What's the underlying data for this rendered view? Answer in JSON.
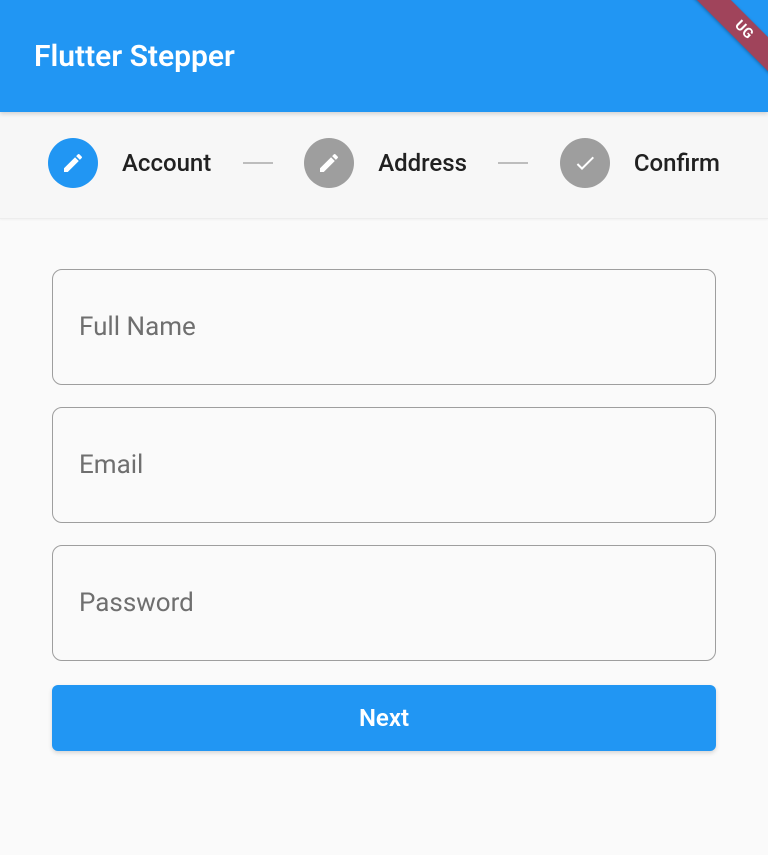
{
  "debug_label": "UG",
  "app_bar": {
    "title": "Flutter Stepper"
  },
  "stepper": {
    "steps": [
      {
        "label": "Account",
        "icon": "edit",
        "active": true
      },
      {
        "label": "Address",
        "icon": "edit",
        "active": false
      },
      {
        "label": "Confirm",
        "icon": "check",
        "active": false
      }
    ]
  },
  "form": {
    "fields": [
      {
        "name": "full-name",
        "placeholder": "Full Name",
        "value": ""
      },
      {
        "name": "email",
        "placeholder": "Email",
        "value": ""
      },
      {
        "name": "password",
        "placeholder": "Password",
        "value": ""
      }
    ],
    "next_label": "Next"
  }
}
